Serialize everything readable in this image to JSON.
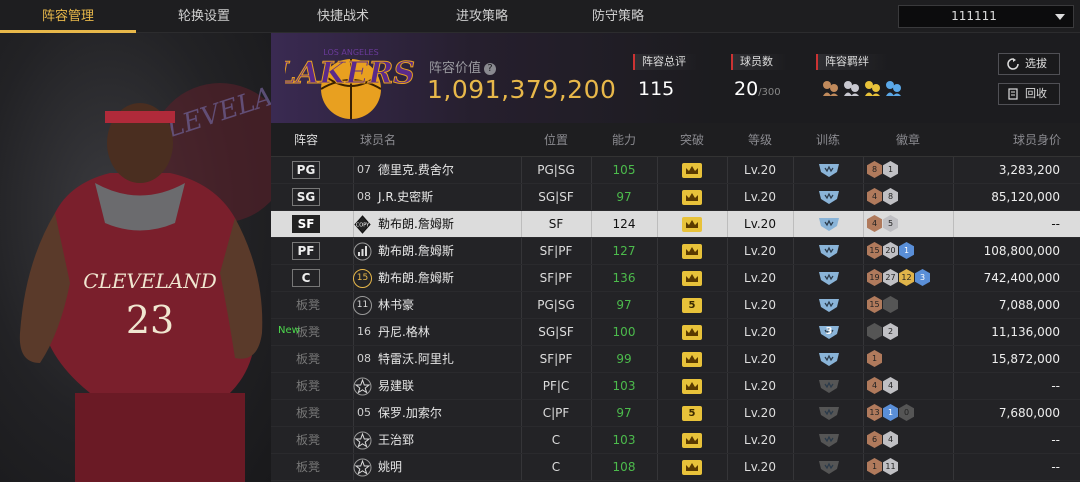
{
  "tabs": [
    "阵容管理",
    "轮换设置",
    "快捷战术",
    "进攻策略",
    "防守策略"
  ],
  "team_select": {
    "value": "111111"
  },
  "header": {
    "value_label": "阵容价值",
    "value_help": "?",
    "value": "1,091,379,200",
    "team_logo_text": "LAKERS",
    "team_logo_city": "LOS ANGELES",
    "stats": [
      {
        "label": "阵容总评",
        "value": "115",
        "sub": ""
      },
      {
        "label": "球员数",
        "value": "20",
        "sub": "/300"
      },
      {
        "label": "阵容羁绊",
        "value": "",
        "sub": ""
      }
    ],
    "buttons": {
      "scout": "选拔",
      "recycle": "回收"
    }
  },
  "player_art": {
    "jersey_city": "CLEVELAND",
    "jersey_number": "23",
    "bg_text": "CLEVELAND CAVALIERS"
  },
  "table": {
    "headers": [
      "阵容",
      "球员名",
      "位置",
      "能力",
      "突破",
      "等级",
      "训练",
      "徽章",
      "球员身价"
    ],
    "rows": [
      {
        "slot": "PG",
        "jersey": "07",
        "name": "德里克.费舍尔",
        "pos": "PG|SG",
        "ability": "105",
        "green": true,
        "breakthrough": "",
        "level": "Lv.20",
        "train": "",
        "badges": [
          {
            "t": "b",
            "v": "8"
          },
          {
            "t": "s",
            "v": "1"
          }
        ],
        "price": "3,283,200"
      },
      {
        "slot": "SG",
        "jersey": "08",
        "name": "J.R.史密斯",
        "pos": "SG|SF",
        "ability": "97",
        "green": true,
        "breakthrough": "",
        "level": "Lv.20",
        "train": "",
        "badges": [
          {
            "t": "b",
            "v": "4"
          },
          {
            "t": "s",
            "v": "8"
          }
        ],
        "price": "85,120,000"
      },
      {
        "slot": "SF",
        "jersey": "COPY",
        "name": "勒布朗.詹姆斯",
        "pos": "SF",
        "ability": "124",
        "green": false,
        "breakthrough": "",
        "level": "Lv.20",
        "train": "",
        "badges": [
          {
            "t": "b",
            "v": "4"
          },
          {
            "t": "s",
            "v": "5"
          }
        ],
        "price": "--",
        "selected": true
      },
      {
        "slot": "PF",
        "jersey": "bar",
        "name": "勒布朗.詹姆斯",
        "pos": "SF|PF",
        "ability": "127",
        "green": true,
        "breakthrough": "",
        "level": "Lv.20",
        "train": "",
        "badges": [
          {
            "t": "b",
            "v": "15"
          },
          {
            "t": "s",
            "v": "20"
          },
          {
            "t": "bl",
            "v": "1"
          }
        ],
        "price": "108,800,000"
      },
      {
        "slot": "C",
        "jersey": "15",
        "name": "勒布朗.詹姆斯",
        "pos": "SF|PF",
        "ability": "136",
        "green": true,
        "breakthrough": "",
        "level": "Lv.20",
        "train": "",
        "badges": [
          {
            "t": "b",
            "v": "19"
          },
          {
            "t": "s",
            "v": "27"
          },
          {
            "t": "g",
            "v": "12"
          },
          {
            "t": "bl",
            "v": "3"
          }
        ],
        "price": "742,400,000"
      },
      {
        "slot": "板凳",
        "jersey": "11",
        "name": "林书豪",
        "pos": "PG|SG",
        "ability": "97",
        "green": true,
        "breakthrough": "5",
        "level": "Lv.20",
        "train": "",
        "badges": [
          {
            "t": "b",
            "v": "15"
          },
          {
            "t": "d",
            "v": ""
          }
        ],
        "price": "7,088,000"
      },
      {
        "slot": "板凳",
        "jersey": "16",
        "name": "丹尼.格林",
        "pos": "SG|SF",
        "ability": "100",
        "green": true,
        "breakthrough": "",
        "level": "Lv.20",
        "train": "3",
        "badges": [
          {
            "t": "d",
            "v": ""
          },
          {
            "t": "s",
            "v": "2"
          }
        ],
        "price": "11,136,000",
        "new": "New"
      },
      {
        "slot": "板凳",
        "jersey": "08",
        "name": "特雷沃.阿里扎",
        "pos": "SF|PF",
        "ability": "99",
        "green": true,
        "breakthrough": "",
        "level": "Lv.20",
        "train": "",
        "badges": [
          {
            "t": "b",
            "v": "1"
          }
        ],
        "price": "15,872,000"
      },
      {
        "slot": "板凳",
        "jersey": "star",
        "name": "易建联",
        "pos": "PF|C",
        "ability": "103",
        "green": true,
        "breakthrough": "",
        "level": "Lv.20",
        "train": "",
        "badges": [
          {
            "t": "b",
            "v": "4"
          },
          {
            "t": "s",
            "v": "4"
          }
        ],
        "price": "--"
      },
      {
        "slot": "板凳",
        "jersey": "05",
        "name": "保罗.加索尔",
        "pos": "C|PF",
        "ability": "97",
        "green": true,
        "breakthrough": "5",
        "level": "Lv.20",
        "train": "",
        "badges": [
          {
            "t": "b",
            "v": "13"
          },
          {
            "t": "bl",
            "v": "1"
          },
          {
            "t": "d",
            "v": "0"
          }
        ],
        "price": "7,680,000"
      },
      {
        "slot": "板凳",
        "jersey": "star",
        "name": "王治郅",
        "pos": "C",
        "ability": "103",
        "green": true,
        "breakthrough": "",
        "level": "Lv.20",
        "train": "",
        "badges": [
          {
            "t": "b",
            "v": "6"
          },
          {
            "t": "s",
            "v": "4"
          }
        ],
        "price": "--"
      },
      {
        "slot": "板凳",
        "jersey": "star",
        "name": "姚明",
        "pos": "C",
        "ability": "108",
        "green": true,
        "breakthrough": "",
        "level": "Lv.20",
        "train": "",
        "badges": [
          {
            "t": "b",
            "v": "1"
          },
          {
            "t": "s",
            "v": "11"
          }
        ],
        "price": "--"
      }
    ]
  }
}
